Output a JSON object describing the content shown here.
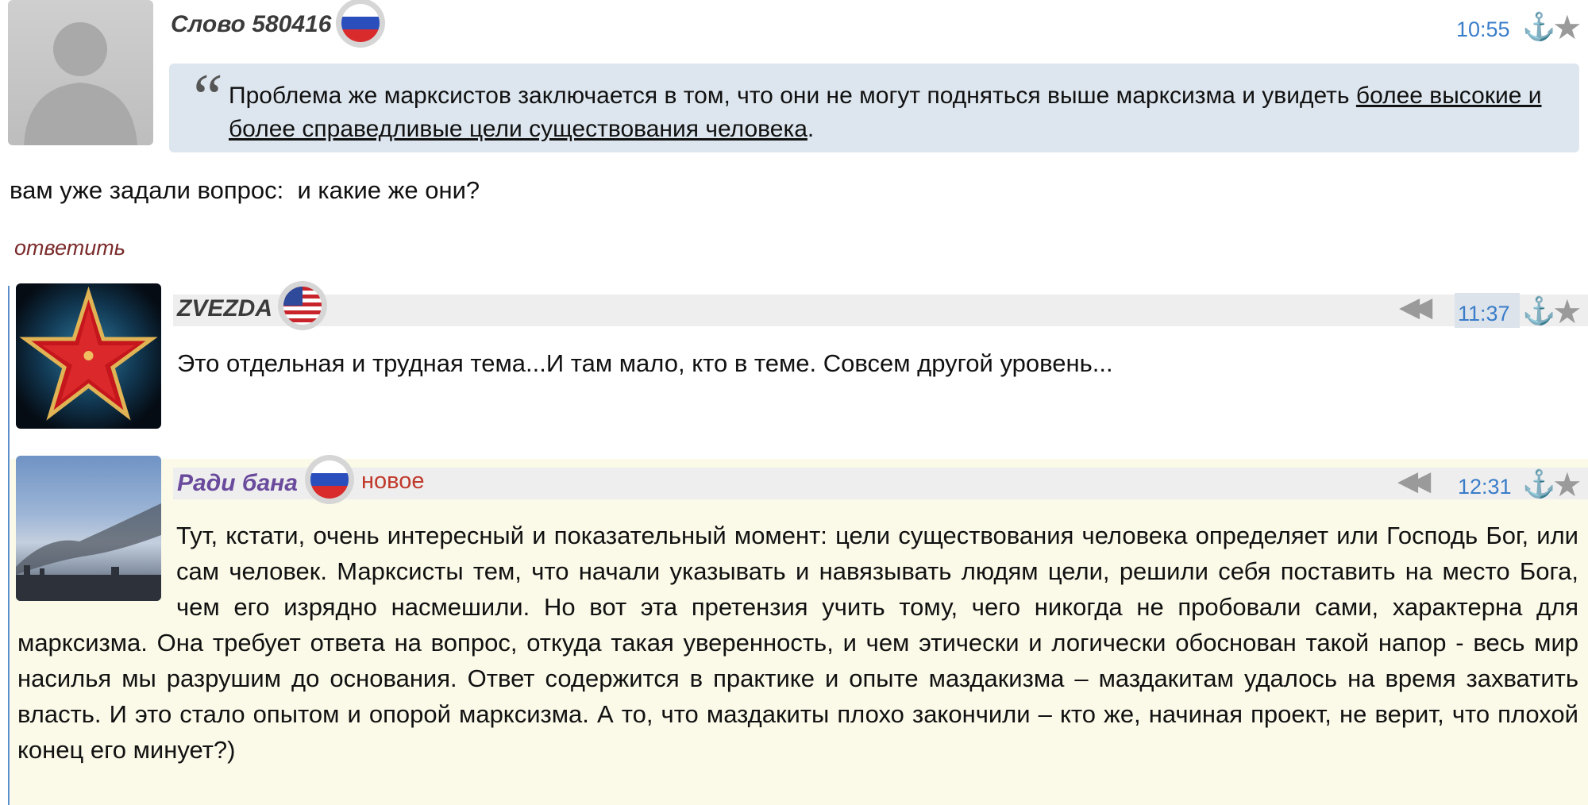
{
  "comments": [
    {
      "author": "Слово 580416",
      "country_flag": "russia",
      "time": "10:55",
      "quote": {
        "text_plain": "Проблема же марксистов заключается в том, что они не могут подняться выше марксизма и увидеть ",
        "text_underlined": "более высокие и более справедливые цели существования человека",
        "text_end": "."
      },
      "body": "вам уже задали вопрос:  и какие же они?",
      "reply_label": "ответить"
    },
    {
      "author": "ZVEZDA",
      "country_flag": "usa",
      "time": "11:37",
      "body": "Это отдельная и трудная тема...И там мало, кто в теме. Совсем другой уровень..."
    },
    {
      "author": "Ради бана",
      "country_flag": "russia",
      "new_badge": "новое",
      "time": "12:31",
      "body": "Тут, кстати, очень интересный и показательный момент: цели существования человека определяет или Господь Бог, или сам человек. Марксисты тем, что начали указывать и навязывать людям цели, решили себя поставить на место Бога, чем его изрядно насмешили. Но вот эта претензия учить тому, чего никогда не пробовали сами, характерна для марксизма. Она требует ответа на вопрос, откуда такая уверенность, и чем этически и логически обоснован такой напор - весь мир насилья мы разрушим до основания. Ответ содержится в практике и опыте маздакизма – маздакитам удалось на время захватить власть. И это стало опытом и опорой марксизма. А то, что маздакиты плохо закончили – кто же, начиная проект, не верит, что плохой конец его минует?)"
    }
  ],
  "icons": {
    "anchor": "⚓",
    "star": "★",
    "rewind": "◀◀",
    "quote_mark": "“"
  },
  "colors": {
    "time": "#3a7dc9",
    "author_default": "#3b3b3b",
    "author_new": "#6a4a9c",
    "new_badge": "#c0392b",
    "reply_link": "#7a2a2a",
    "quote_bg": "#dde6ee",
    "header_bar_bg": "#eeeeee",
    "new_post_bg": "#fbf9e8",
    "thread_line": "#5a8fc7"
  }
}
